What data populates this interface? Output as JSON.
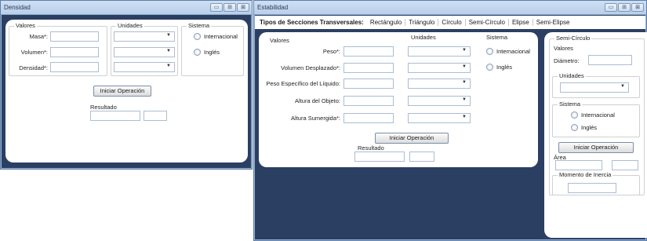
{
  "densidad": {
    "title": "Densidad",
    "controls": [
      "▭",
      "⊞",
      "⊠"
    ],
    "valores_label": "Valores",
    "unidades_label": "Unidades",
    "sistema_label": "Sistema",
    "fields": [
      {
        "label": "Masa*:",
        "value": ""
      },
      {
        "label": "Volumen*:",
        "value": ""
      },
      {
        "label": "Densidad*:",
        "value": ""
      }
    ],
    "radios": [
      "Internacional",
      "Inglés"
    ],
    "button": "Iniciar Operación",
    "resultado_label": "Resultado"
  },
  "estabilidad": {
    "title": "Estabilidad",
    "controls": [
      "▭",
      "⊞",
      "⊠"
    ],
    "menu_title": "Tipos de Secciones Transversales:",
    "menu_items": [
      "Rectángulo",
      "Triángulo",
      "Círculo",
      "Semi-Círculo",
      "Elipse",
      "Semi-Elipse"
    ],
    "valores_label": "Valores",
    "unidades_label": "Unidades",
    "sistema_label": "Sistema",
    "fields": [
      {
        "label": "Peso*:",
        "value": ""
      },
      {
        "label": "Volumen Desplazado*:",
        "value": ""
      },
      {
        "label": "Peso Específico del Líquido:",
        "value": ""
      },
      {
        "label": "Altura del Objeto:",
        "value": ""
      },
      {
        "label": "Altura Sumergida*:",
        "value": ""
      }
    ],
    "radios": [
      "Internacional",
      "Inglés"
    ],
    "button": "Iniciar Operación",
    "resultado_label": "Resultado",
    "semi": {
      "group_label": "Semi-Círculo",
      "valores_label": "Valores",
      "diametro_label": "Diámetro:",
      "unidades_label": "Unidades",
      "sistema_label": "Sistema",
      "radios": [
        "Internacional",
        "Inglés"
      ],
      "button": "Iniciar Operación",
      "area_label": "Área",
      "momento_label": "Momento de Inercia"
    }
  }
}
